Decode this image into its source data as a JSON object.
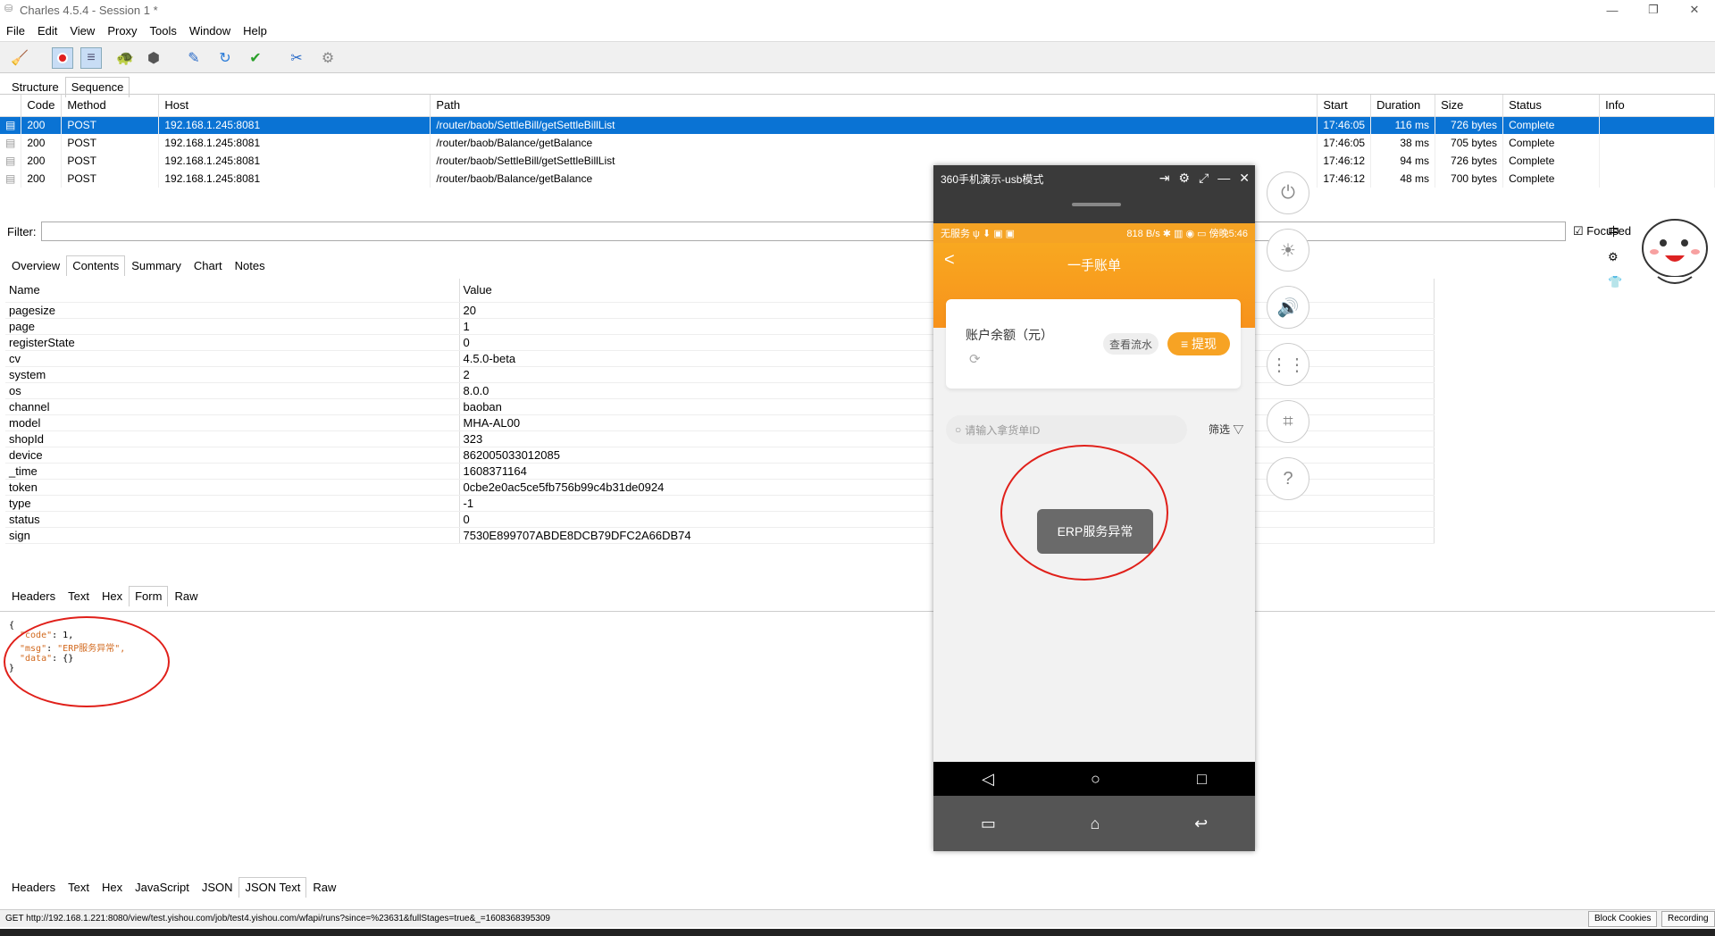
{
  "window": {
    "title": "Charles 4.5.4 - Session 1 *",
    "minimize": "—",
    "restore": "❐",
    "close": "✕"
  },
  "menu": [
    "File",
    "Edit",
    "View",
    "Proxy",
    "Tools",
    "Window",
    "Help"
  ],
  "toolbar_icons": [
    "broom-icon",
    "record-icon",
    "throttle-icon",
    "turtle-icon",
    "stop-icon",
    "pen-icon",
    "refresh-icon",
    "check-icon",
    "tools-icon",
    "gear-icon"
  ],
  "view_tabs": [
    "Structure",
    "Sequence"
  ],
  "sequence": {
    "columns": [
      "Code",
      "Method",
      "Host",
      "Path",
      "Start",
      "Duration",
      "Size",
      "Status",
      "Info"
    ],
    "rows": [
      {
        "code": "200",
        "method": "POST",
        "host": "192.168.1.245:8081",
        "path": "/router/baob/SettleBill/getSettleBillList",
        "start": "17:46:05",
        "duration": "116 ms",
        "size": "726 bytes",
        "status": "Complete"
      },
      {
        "code": "200",
        "method": "POST",
        "host": "192.168.1.245:8081",
        "path": "/router/baob/Balance/getBalance",
        "start": "17:46:05",
        "duration": "38 ms",
        "size": "705 bytes",
        "status": "Complete"
      },
      {
        "code": "200",
        "method": "POST",
        "host": "192.168.1.245:8081",
        "path": "/router/baob/SettleBill/getSettleBillList",
        "start": "17:46:12",
        "duration": "94 ms",
        "size": "726 bytes",
        "status": "Complete"
      },
      {
        "code": "200",
        "method": "POST",
        "host": "192.168.1.245:8081",
        "path": "/router/baob/Balance/getBalance",
        "start": "17:46:12",
        "duration": "48 ms",
        "size": "700 bytes",
        "status": "Complete"
      }
    ]
  },
  "filter": {
    "label": "Filter:",
    "value": "",
    "focused_label": "Focused"
  },
  "detail_tabs": [
    "Overview",
    "Contents",
    "Summary",
    "Chart",
    "Notes"
  ],
  "form": {
    "columns": [
      "Name",
      "Value"
    ],
    "rows": [
      [
        "pagesize",
        "20"
      ],
      [
        "page",
        "1"
      ],
      [
        "registerState",
        "0"
      ],
      [
        "cv",
        "4.5.0-beta"
      ],
      [
        "system",
        "2"
      ],
      [
        "os",
        "8.0.0"
      ],
      [
        "channel",
        "baoban"
      ],
      [
        "model",
        "MHA-AL00"
      ],
      [
        "shopId",
        "323"
      ],
      [
        "device",
        "862005033012085"
      ],
      [
        "_time",
        "1608371164"
      ],
      [
        "token",
        "0cbe2e0ac5ce5fb756b99c4b31de0924"
      ],
      [
        "type",
        "-1"
      ],
      [
        "status",
        "0"
      ],
      [
        "sign",
        "7530E899707ABDE8DCB79DFC2A66DB74"
      ]
    ]
  },
  "request_tabs": [
    "Headers",
    "Text",
    "Hex",
    "Form",
    "Raw"
  ],
  "json": {
    "open": "{",
    "lines": [
      {
        "key": "\"code\"",
        "val": " 1,"
      },
      {
        "key": "\"msg\"",
        "val": " \"ERP服务异常\","
      },
      {
        "key": "\"data\"",
        "val": " {}"
      }
    ],
    "close": "}"
  },
  "response_tabs": [
    "Headers",
    "Text",
    "Hex",
    "JavaScript",
    "JSON",
    "JSON Text",
    "Raw"
  ],
  "statusbar": {
    "text": "GET http://192.168.1.221:8080/view/test.yishou.com/job/test4.yishou.com/wfapi/runs?since=%23631&fullStages=true&_=1608368395309",
    "block_cookies": "Block Cookies",
    "recording": "Recording"
  },
  "phone": {
    "title": "360手机演示-usb模式",
    "status_left": "无服务 ψ ⬇ ▣ ▣",
    "status_right": "818 B/s ✱ ▥ ◉ ▭ 傍晚5:46",
    "back": "<",
    "header_title": "一手账单",
    "balance_label": "账户余额（元）",
    "refresh": "⟳",
    "flow_button": "查看流水",
    "withdraw_button": "≡ 提现",
    "search_placeholder": "请输入拿货单ID",
    "filter_label": "筛选 ▽",
    "toast": "ERP服务异常",
    "nav": [
      "◁",
      "○",
      "□"
    ],
    "bottom": [
      "▭",
      "⌂",
      "↩"
    ]
  },
  "side_icons": [
    "power-icon",
    "brightness-icon",
    "volume-icon",
    "keyboard-icon",
    "crop-icon",
    "help-icon"
  ],
  "side_glyphs": [
    "⏻",
    "☀",
    "🔊",
    "⋮⋮",
    "⌗",
    "?"
  ],
  "mini_icons": [
    "中",
    "⚙",
    "👕"
  ],
  "colors": {
    "selection": "#0a73d4",
    "accent_orange": "#f7a324",
    "annotation_red": "#e0201a"
  }
}
